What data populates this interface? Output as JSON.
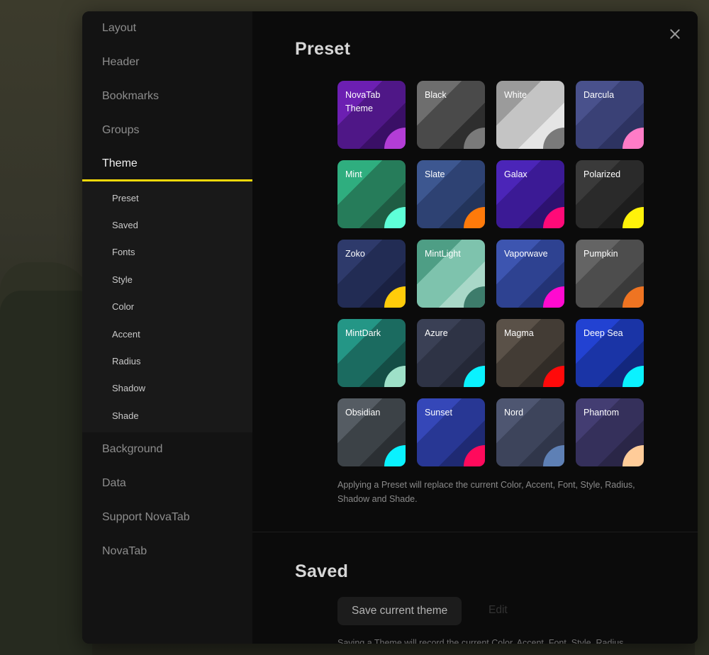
{
  "sidebar": {
    "top_items": [
      "Layout",
      "Header",
      "Bookmarks",
      "Groups"
    ],
    "active_item": "Theme",
    "sub_items": [
      "Preset",
      "Saved",
      "Fonts",
      "Style",
      "Color",
      "Accent",
      "Radius",
      "Shadow",
      "Shade"
    ],
    "bottom_items": [
      "Background",
      "Data",
      "Support NovaTab",
      "NovaTab"
    ]
  },
  "preset": {
    "title": "Preset",
    "themes": [
      {
        "name": "NovaTab Theme",
        "colors": [
          "#6c1fb2",
          "#4f1787",
          "#3a0f66"
        ],
        "accent": "#b33dd6"
      },
      {
        "name": "Black",
        "colors": [
          "#6e6e6e",
          "#4a4a4a",
          "#2e2e2e"
        ],
        "accent": "#7a7a7a"
      },
      {
        "name": "White",
        "colors": [
          "#9b9b9b",
          "#c4c4c4",
          "#e5e5e5"
        ],
        "accent": "#7a7a7a"
      },
      {
        "name": "Darcula",
        "colors": [
          "#49518c",
          "#3a4176",
          "#2d3361"
        ],
        "accent": "#ff7cc7"
      },
      {
        "name": "Mint",
        "colors": [
          "#2fae7f",
          "#267c5a",
          "#1f5c43"
        ],
        "accent": "#5effd8"
      },
      {
        "name": "Slate",
        "colors": [
          "#3d5790",
          "#2e4273",
          "#23345b"
        ],
        "accent": "#ff7a0a"
      },
      {
        "name": "Galax",
        "colors": [
          "#4b25b8",
          "#3b1a95",
          "#2d1270"
        ],
        "accent": "#ff0a78"
      },
      {
        "name": "Polarized",
        "colors": [
          "#3a3a3a",
          "#2a2a2a",
          "#1d1d1d"
        ],
        "accent": "#fff20a"
      },
      {
        "name": "Zoko",
        "colors": [
          "#2e3a6b",
          "#222c54",
          "#1a2142"
        ],
        "accent": "#ffcc0a"
      },
      {
        "name": "MintLight",
        "colors": [
          "#4e9e85",
          "#7ec3ad",
          "#a9d8c8"
        ],
        "accent": "#3d7c6b"
      },
      {
        "name": "Vaporwave",
        "colors": [
          "#3d55b0",
          "#2e4291",
          "#233375"
        ],
        "accent": "#ff0ad0"
      },
      {
        "name": "Pumpkin",
        "colors": [
          "#646464",
          "#4d4d4d",
          "#3a3a3a"
        ],
        "accent": "#ef7422"
      },
      {
        "name": "MintDark",
        "colors": [
          "#249686",
          "#1b6b60",
          "#144d45"
        ],
        "accent": "#9ee0c8"
      },
      {
        "name": "Azure",
        "colors": [
          "#3a4055",
          "#2e3345",
          "#242837"
        ],
        "accent": "#0af2ff"
      },
      {
        "name": "Magma",
        "colors": [
          "#5a5148",
          "#433c35",
          "#312c27"
        ],
        "accent": "#ff0a0a"
      },
      {
        "name": "Deep Sea",
        "colors": [
          "#2242d2",
          "#1a34a6",
          "#13277d"
        ],
        "accent": "#0af2ff"
      },
      {
        "name": "Obsidian",
        "colors": [
          "#555c63",
          "#3c4247",
          "#2b2f33"
        ],
        "accent": "#0af2ff"
      },
      {
        "name": "Sunset",
        "colors": [
          "#3547b8",
          "#283794",
          "#1f2a73"
        ],
        "accent": "#ff0a5c"
      },
      {
        "name": "Nord",
        "colors": [
          "#4e5671",
          "#3d445b",
          "#30364a"
        ],
        "accent": "#5e80b5"
      },
      {
        "name": "Phantom",
        "colors": [
          "#433d72",
          "#35305b",
          "#2a2647"
        ],
        "accent": "#ffcc99"
      }
    ],
    "hint": "Applying a Preset will replace the current Color, Accent, Font, Style, Radius, Shadow and Shade."
  },
  "saved": {
    "title": "Saved",
    "save_button": "Save current theme",
    "edit_button": "Edit",
    "hint": "Saving a Theme will record the current Color, Accent, Font, Style, Radius"
  }
}
